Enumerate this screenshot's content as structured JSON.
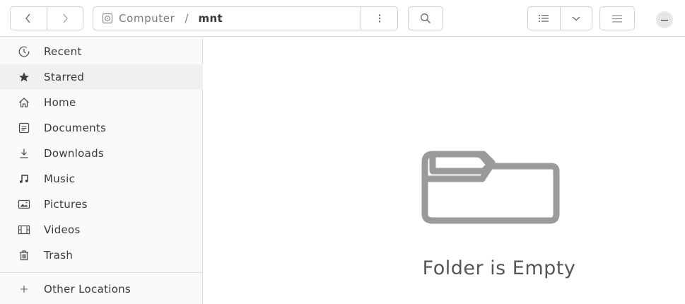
{
  "header": {
    "path": {
      "root_label": "Computer",
      "separator": "/",
      "current": "mnt"
    }
  },
  "sidebar": {
    "items": [
      {
        "label": "Recent",
        "icon": "clock-icon"
      },
      {
        "label": "Starred",
        "icon": "star-icon"
      },
      {
        "label": "Home",
        "icon": "home-icon"
      },
      {
        "label": "Documents",
        "icon": "document-icon"
      },
      {
        "label": "Downloads",
        "icon": "download-icon"
      },
      {
        "label": "Music",
        "icon": "music-icon"
      },
      {
        "label": "Pictures",
        "icon": "picture-icon"
      },
      {
        "label": "Videos",
        "icon": "video-icon"
      },
      {
        "label": "Trash",
        "icon": "trash-icon"
      }
    ],
    "other_locations": {
      "label": "Other Locations",
      "icon": "plus-icon"
    }
  },
  "main": {
    "empty_message": "Folder is Empty",
    "empty_icon": "folder-icon"
  },
  "colors": {
    "icon_gray": "#8c8c8c",
    "sidebar_bg": "#fafafa",
    "sidebar_alt_row": "#f0f0f0",
    "border": "#cfcfcf"
  }
}
